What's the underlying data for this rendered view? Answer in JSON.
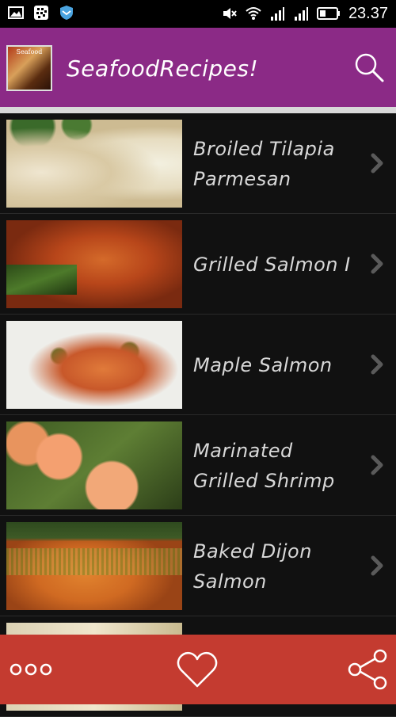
{
  "status_bar": {
    "time": "23.37",
    "icons": [
      "image-icon",
      "bbm-icon",
      "shield-icon",
      "mute-icon",
      "wifi-icon",
      "signal-icon",
      "signal-icon",
      "battery-icon"
    ]
  },
  "app_bar": {
    "logo_text": "Seafood",
    "title": "SeafoodRecipes!",
    "search_icon": "search-icon",
    "color": "#8b2a86"
  },
  "recipes": [
    {
      "label": "Broiled Tilapia Parmesan"
    },
    {
      "label": "Grilled Salmon I"
    },
    {
      "label": "Maple Salmon"
    },
    {
      "label": "Marinated Grilled Shrimp"
    },
    {
      "label": "Baked Dijon Salmon"
    }
  ],
  "bottom_bar": {
    "color": "#c43b30",
    "icons": [
      "more-icon",
      "heart-icon",
      "share-icon"
    ]
  }
}
